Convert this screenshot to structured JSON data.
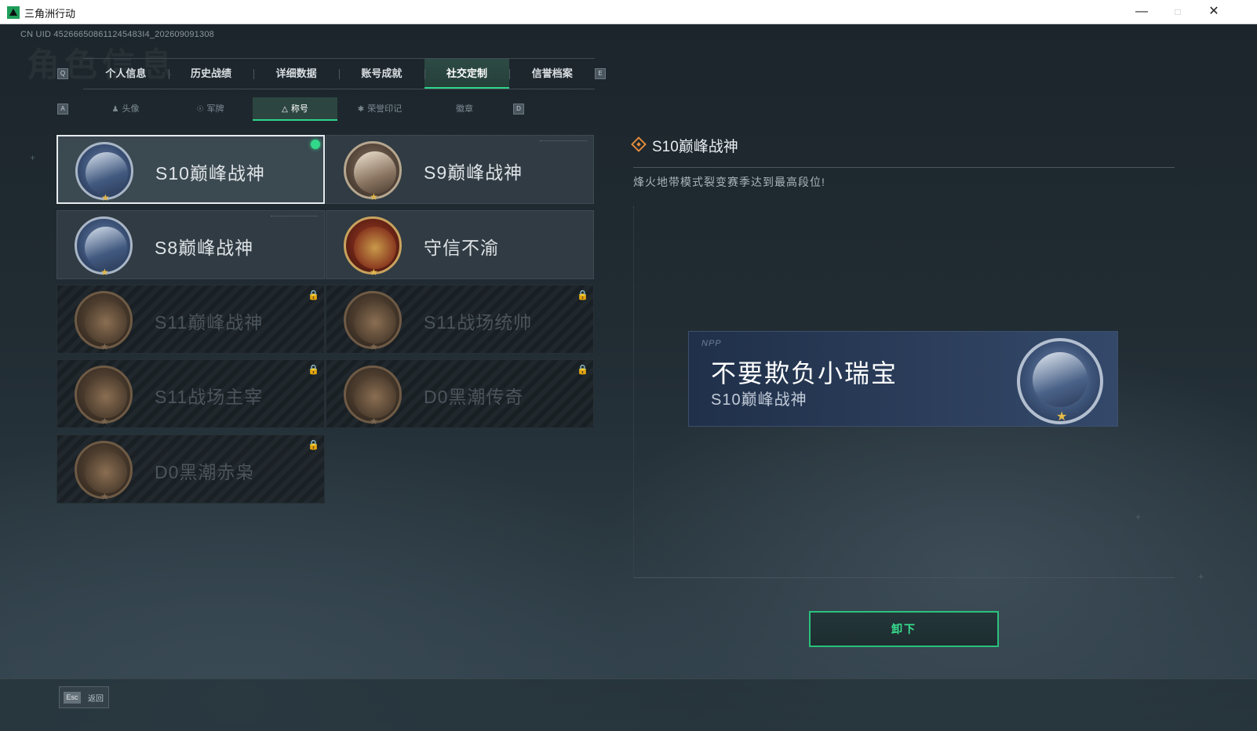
{
  "window": {
    "title": "三角洲行动",
    "minimize": "—",
    "maximize": "□",
    "close": "✕"
  },
  "header": {
    "uid": "CN UID 452666508611245483I4_202609091308",
    "ghost_title": "角色信息"
  },
  "main_tabs": {
    "key_left": "Q",
    "key_right": "E",
    "items": [
      {
        "label": "个人信息"
      },
      {
        "label": "历史战绩"
      },
      {
        "label": "详细数据"
      },
      {
        "label": "账号成就"
      },
      {
        "label": "社交定制"
      },
      {
        "label": "信誉档案"
      }
    ],
    "active_index": 4
  },
  "sub_tabs": {
    "key_left": "A",
    "key_right": "D",
    "items": [
      {
        "label": "头像",
        "icon": "person-icon"
      },
      {
        "label": "军牌",
        "icon": "tag-icon"
      },
      {
        "label": "称号",
        "icon": "triangle-icon"
      },
      {
        "label": "荣誉印记",
        "icon": "emblem-icon"
      },
      {
        "label": "徽章",
        "icon": ""
      }
    ],
    "active_index": 2
  },
  "titles": [
    {
      "label": "S10巅峰战神",
      "locked": false,
      "selected": true,
      "equipped": true,
      "style": "blue"
    },
    {
      "label": "S9巅峰战神",
      "locked": false,
      "selected": false,
      "equipped": false,
      "style": "stone"
    },
    {
      "label": "S8巅峰战神",
      "locked": false,
      "selected": false,
      "equipped": false,
      "style": "blue"
    },
    {
      "label": "守信不渝",
      "locked": false,
      "selected": false,
      "equipped": false,
      "style": "red"
    },
    {
      "label": "S11巅峰战神",
      "locked": true,
      "selected": false,
      "equipped": false,
      "style": "bronze"
    },
    {
      "label": "S11战场统帅",
      "locked": true,
      "selected": false,
      "equipped": false,
      "style": "bronze"
    },
    {
      "label": "S11战场主宰",
      "locked": true,
      "selected": false,
      "equipped": false,
      "style": "bronze"
    },
    {
      "label": "D0黑潮传奇",
      "locked": true,
      "selected": false,
      "equipped": false,
      "style": "bronze"
    },
    {
      "label": "D0黑潮赤枭",
      "locked": true,
      "selected": false,
      "equipped": false,
      "style": "bronze"
    }
  ],
  "detail": {
    "title": "S10巅峰战神",
    "description": "烽火地带模式裂变赛季达到最高段位!"
  },
  "nameplate": {
    "logo": "NPP",
    "player_name": "不要欺负小瑞宝",
    "title": "S10巅峰战神"
  },
  "actions": {
    "unequip_label": "卸下"
  },
  "footer": {
    "esc_key": "Esc",
    "esc_label": "返回"
  },
  "colors": {
    "accent_green": "#2fd38a",
    "detail_icon_orange": "#e38a3c",
    "star_gold": "#e0b64a"
  }
}
